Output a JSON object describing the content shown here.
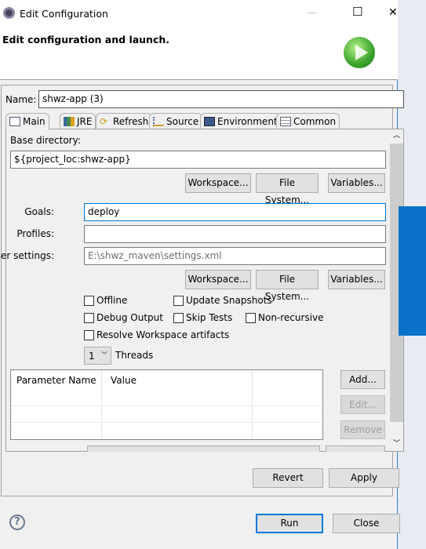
{
  "window": {
    "title": "Edit Configuration",
    "minimize": "—",
    "maximize": "☐",
    "close": "✕"
  },
  "header": {
    "title": "Edit configuration and launch."
  },
  "name": {
    "label": "Name:",
    "value": "shwz-app (3)"
  },
  "tabs": [
    {
      "label": "Main",
      "icon": "main-tab-icon",
      "active": true
    },
    {
      "label": "JRE",
      "icon": "books-icon"
    },
    {
      "label": "Refresh",
      "icon": "refresh-icon"
    },
    {
      "label": "Source",
      "icon": "source-icon"
    },
    {
      "label": "Environment",
      "icon": "environment-icon"
    },
    {
      "label": "Common",
      "icon": "table-icon"
    }
  ],
  "main": {
    "base_dir_label": "Base directory:",
    "base_dir_value": "${project_loc:shwz-app}",
    "workspace": "Workspace...",
    "file_system": "File System...",
    "variables": "Variables...",
    "goals_label": "Goals:",
    "goals_value": "deploy",
    "profiles_label": "Profiles:",
    "profiles_value": "",
    "user_settings_label": "User settings:",
    "user_settings_value": "E:\\shwz_maven\\settings.xml",
    "checkboxes": {
      "offline": "Offline",
      "update_snapshots": "Update Snapshots",
      "debug_output": "Debug Output",
      "skip_tests": "Skip Tests",
      "non_recursive": "Non-recursive",
      "resolve_workspace": "Resolve Workspace artifacts"
    },
    "threads_value": "1",
    "threads_label": "Threads",
    "table": {
      "columns": [
        "Parameter Name",
        "Value",
        ""
      ],
      "rows": []
    },
    "add": "Add...",
    "edit": "Edit...",
    "remove": "Remove"
  },
  "footer": {
    "revert": "Revert",
    "apply": "Apply",
    "run": "Run",
    "close": "Close",
    "help": "?"
  }
}
